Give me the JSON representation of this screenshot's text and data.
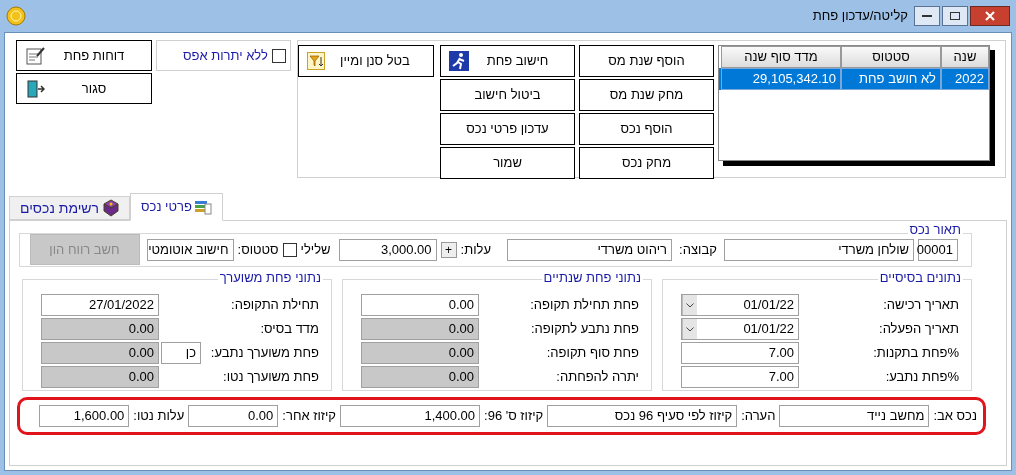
{
  "window": {
    "title": "קליטה/עדכון פחת"
  },
  "years_table": {
    "columns": [
      "שנה",
      "סטטוס",
      "מדד סוף שנה"
    ],
    "rows": [
      {
        "cells": [
          "2022",
          "לא חושב פחת",
          "29,105,342.10"
        ],
        "selected": true
      }
    ]
  },
  "action_buttons": [
    {
      "label": "הוסף שנת מס",
      "kind": "plain"
    },
    {
      "label": "מחק שנת מס",
      "kind": "plain"
    },
    {
      "label": "הוסף נכס",
      "kind": "plain"
    },
    {
      "label": "מחק נכס",
      "kind": "plain"
    },
    {
      "label": "חישוב פחת",
      "kind": "runner"
    },
    {
      "label": "ביטול חישוב",
      "kind": "plain"
    },
    {
      "label": "עדכון פרטי נכס",
      "kind": "plain"
    },
    {
      "label": "שמור",
      "kind": "plain"
    }
  ],
  "filter_button": {
    "label": "בטל סנן ומיין"
  },
  "zero_balance": {
    "label": "ללא יתרות אפס",
    "checked": false
  },
  "side_buttons": [
    {
      "label": "דוחות פחת",
      "kind": "report"
    },
    {
      "label": "סגור",
      "kind": "exit"
    }
  ],
  "tabs": [
    {
      "label": "פרטי נכס",
      "selected": true,
      "kind": "data"
    },
    {
      "label": "רשימת נכסים",
      "selected": false,
      "kind": "book"
    }
  ],
  "asset": {
    "title": "תאור נכס",
    "code": "00001",
    "description": "שולחן משרדי",
    "group_label": "קבוצה:",
    "group": "ריהוט משרדי",
    "plus": "+",
    "cost_label": "עלות:",
    "cost": "3,000.00",
    "negative": {
      "label": "שלילי",
      "checked": false
    },
    "status_label": "סטטוס:",
    "status": "חישוב אוטומטי",
    "capital_gain_button": {
      "label": "חשב רווח הון",
      "disabled": true
    }
  },
  "sections": [
    {
      "title": "נתונים בסיסיים",
      "rows": [
        {
          "label": "תאריך רכישה:",
          "value": "01/01/22",
          "kind": "date",
          "readonly": false
        },
        {
          "label": "תאריך הפעלה:",
          "value": "01/01/22",
          "kind": "date",
          "readonly": false
        },
        {
          "label": "%פחת בתקנות:",
          "value": "7.00",
          "kind": "text",
          "readonly": false
        },
        {
          "label": "%פחת נתבע:",
          "value": "7.00",
          "kind": "text",
          "readonly": false
        }
      ]
    },
    {
      "title": "נתוני פחת שנתיים",
      "rows": [
        {
          "label": "פחת תחילת תקופה:",
          "value": "0.00",
          "kind": "text",
          "readonly": false
        },
        {
          "label": "פחת נתבע לתקופה:",
          "value": "0.00",
          "kind": "text",
          "readonly": true
        },
        {
          "label": "פחת סוף תקופה:",
          "value": "0.00",
          "kind": "text",
          "readonly": true
        },
        {
          "label": "יתרה להפחתה:",
          "value": "0.00",
          "kind": "text",
          "readonly": true
        }
      ]
    },
    {
      "title": "נתוני פחת משוערך",
      "rows": [
        {
          "label": "תחילת התקופה:",
          "value": "27/01/2022",
          "kind": "text",
          "readonly": false
        },
        {
          "label": "מדד בסיס:",
          "value": "0.00",
          "kind": "text",
          "readonly": true
        },
        {
          "label": "פחת משוערך נתבע:",
          "value": "0.00",
          "kind": "text",
          "readonly": true,
          "extra": "כן"
        },
        {
          "label": "פחת משוערך נטו:",
          "value": "0.00",
          "kind": "text",
          "readonly": true
        }
      ]
    }
  ],
  "bottom_fields": [
    {
      "label": "נכס אב:",
      "value": "מחשב נייד"
    },
    {
      "label": "הערה:",
      "value": "קיזוז לפי סעיף 96 נכס"
    },
    {
      "label": "קיזוז ס' 96:",
      "value": "1,400.00"
    },
    {
      "label": "קיזוז אחר:",
      "value": "0.00"
    },
    {
      "label": "עלות נטו:",
      "value": "1,600.00"
    }
  ]
}
